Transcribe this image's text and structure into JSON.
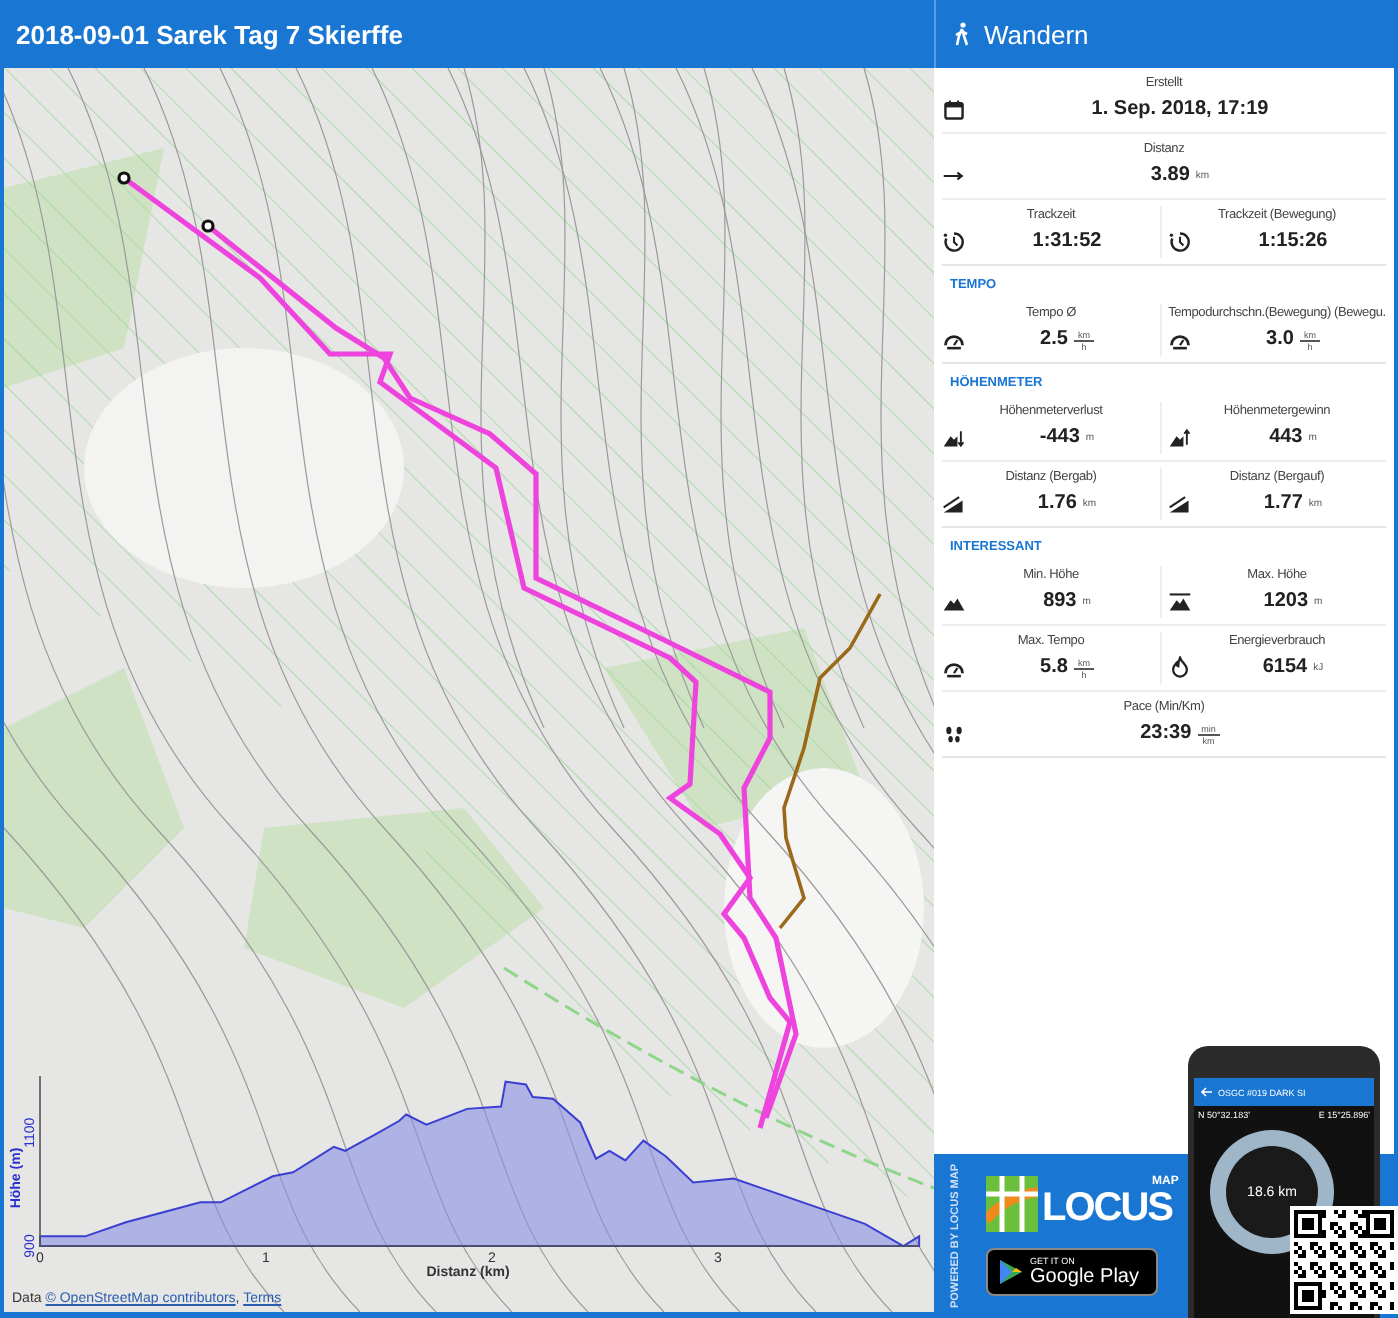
{
  "title": "2018-09-01 Sarek Tag 7 Skierffe",
  "activity": {
    "label": "Wandern"
  },
  "map": {
    "attribution": {
      "prefix": "Data",
      "link": "© OpenStreetMap contributors",
      "separator": ",",
      "terms": "Terms"
    },
    "elevation_profile": {
      "chart_data": {
        "type": "area",
        "xlabel": "Distanz (km)",
        "ylabel": "Höhe (m)",
        "x": [
          0,
          0.2,
          0.38,
          0.71,
          0.8,
          1.03,
          1.12,
          1.3,
          1.35,
          1.48,
          1.59,
          1.62,
          1.71,
          1.89,
          2.04,
          2.06,
          2.15,
          2.18,
          2.27,
          2.39,
          2.46,
          2.52,
          2.59,
          2.67,
          2.77,
          2.89,
          3.07,
          3.65,
          3.82,
          3.89
        ],
        "series": [
          {
            "color": "#3a3fd0",
            "values": [
              917,
              917,
              942,
              977,
              977,
              1023,
              1030,
              1075,
              1068,
              1096,
              1121,
              1132,
              1114,
              1142,
              1146,
              1190,
              1185,
              1163,
              1160,
              1118,
              1054,
              1068,
              1051,
              1086,
              1058,
              1012,
              1019,
              939,
              900,
              917
            ]
          }
        ],
        "xlim": [
          0,
          3.89
        ],
        "ylim": [
          900,
          1200
        ],
        "xticks": [
          0,
          1,
          2,
          3
        ],
        "yticks": [
          900,
          1100
        ]
      }
    }
  },
  "stats": {
    "sections": [
      {
        "rows": [
          [
            {
              "kind": "calendar",
              "label": "Erstellt",
              "value": "1. Sep. 2018, 17:19"
            }
          ],
          [
            {
              "kind": "distance",
              "label": "Distanz",
              "value": "3.89",
              "unit": "km"
            }
          ],
          [
            {
              "kind": "time",
              "label": "Trackzeit",
              "value": "1:31:52"
            },
            {
              "kind": "time",
              "label": "Trackzeit (Bewegung)",
              "value": "1:15:26"
            }
          ]
        ]
      },
      {
        "title": "TEMPO",
        "rows": [
          [
            {
              "kind": "speed",
              "label": "Tempo Ø",
              "value": "2.5",
              "unit_top": "km",
              "unit_bottom": "h"
            },
            {
              "kind": "speed",
              "label": "Tempodurchschn.(Bewegung) (Bewegu.",
              "value": "3.0",
              "unit_top": "km",
              "unit_bottom": "h"
            }
          ]
        ]
      },
      {
        "title": "HÖHENMETER",
        "rows": [
          [
            {
              "kind": "loss",
              "label": "Höhenmeterverlust",
              "value": "-443",
              "unit": "m"
            },
            {
              "kind": "gain",
              "label": "Höhenmetergewinn",
              "value": "443",
              "unit": "m"
            }
          ],
          [
            {
              "kind": "descent",
              "label": "Distanz (Bergab)",
              "value": "1.76",
              "unit": "km"
            },
            {
              "kind": "ascent",
              "label": "Distanz (Bergauf)",
              "value": "1.77",
              "unit": "km"
            }
          ]
        ]
      },
      {
        "title": "INTERESSANT",
        "rows": [
          [
            {
              "kind": "min-altitude",
              "label": "Min. Höhe",
              "value": "893",
              "unit": "m"
            },
            {
              "kind": "max-altitude",
              "label": "Max. Höhe",
              "value": "1203",
              "unit": "m"
            }
          ],
          [
            {
              "kind": "speed",
              "label": "Max. Tempo",
              "value": "5.8",
              "unit_top": "km",
              "unit_bottom": "h"
            },
            {
              "kind": "energy",
              "label": "Energieverbrauch",
              "value": "6154",
              "unit": "kJ"
            }
          ],
          [
            {
              "kind": "pace",
              "label": "Pace (Min/Km)",
              "value": "23:39",
              "unit_top": "min",
              "unit_bottom": "km"
            }
          ]
        ]
      }
    ]
  },
  "promo": {
    "side_text": "POWERED BY LOCUS MAP",
    "logo_text": "LOCUS",
    "logo_sub": "MAP",
    "store_badge": {
      "top": "GET IT ON",
      "bottom": "Google Play"
    },
    "phone": {
      "title": "OSGC #019 DARK SI",
      "lat": "N 50°32.183'",
      "lon": "E 15°25.896'",
      "distance": "18.6 km"
    }
  }
}
